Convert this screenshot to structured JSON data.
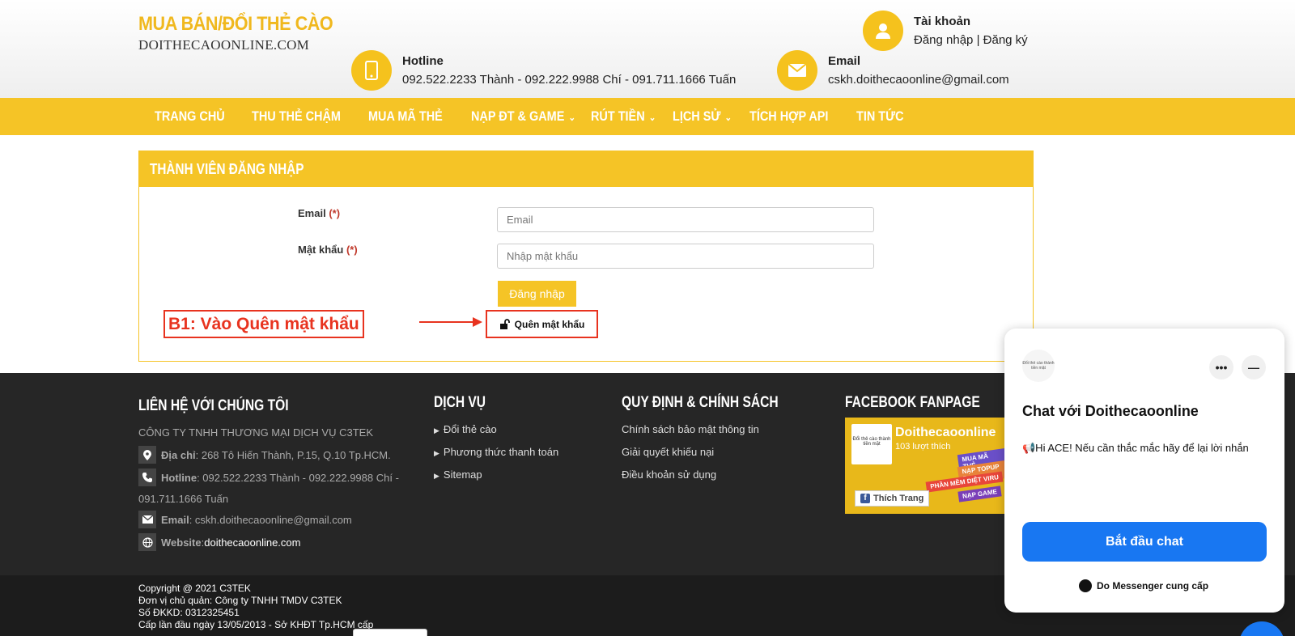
{
  "logo": {
    "top": "MUA BÁN/ĐỔI THẺ CÀO",
    "bottom": "DOITHECAOONLINE.COM"
  },
  "account": {
    "title": "Tài khoản",
    "login": "Đăng nhập",
    "separator": " | ",
    "register": "Đăng ký"
  },
  "hotline": {
    "title": "Hotline",
    "value": "092.522.2233 Thành - 092.222.9988 Chí - 091.711.1666 Tuấn"
  },
  "email": {
    "title": "Email",
    "value": "cskh.doithecaoonline@gmail.com"
  },
  "nav": [
    {
      "label": "TRANG CHỦ"
    },
    {
      "label": "THU THẺ CHẬM"
    },
    {
      "label": "MUA MÃ THẺ"
    },
    {
      "label": "NẠP ĐT & GAME",
      "chevron": "⌄"
    },
    {
      "label": "RÚT TIỀN",
      "chevron": "⌄"
    },
    {
      "label": "LỊCH SỬ",
      "chevron": "⌄"
    },
    {
      "label": "TÍCH HỢP API"
    },
    {
      "label": "TIN TỨC"
    }
  ],
  "login_panel": {
    "title": "THÀNH VIÊN ĐĂNG NHẬP",
    "email_label": "Email",
    "password_label": "Mật khẩu",
    "required": "(*)",
    "email_placeholder": "Email",
    "password_placeholder": "Nhập mật khẩu",
    "submit": "Đăng nhập",
    "forgot": "Quên mật khẩu",
    "annotation": "B1: Vào  Quên mật khẩu"
  },
  "footer": {
    "contact_title": "LIÊN HỆ VỚI CHÚNG TÔI",
    "company": "CÔNG TY TNHH THƯƠNG MẠI DỊCH VỤ C3TEK",
    "address_label": "Địa chỉ",
    "address": ": 268 Tô Hiến Thành, P.15, Q.10 Tp.HCM.",
    "hotline_label": "Hotline",
    "hotline": ": 092.522.2233 Thành - 092.222.9988 Chí -",
    "hotline_cont": "091.711.1666 Tuấn",
    "email_label": "Email",
    "email": ": cskh.doithecaoonline@gmail.com",
    "website_label": "Website",
    "website_sep": ": ",
    "website": "doithecaoonline.com",
    "services_title": "DỊCH VỤ",
    "services": [
      "Đổi thẻ cào",
      "Phương thức thanh toán",
      "Sitemap"
    ],
    "policy_title": "QUY ĐỊNH & CHÍNH SÁCH",
    "policies": [
      "Chính sách bảo mật thông tin",
      "Giải quyết khiếu nại",
      "Điều khoản sử dụng"
    ],
    "fanpage_title": "FACEBOOK FANPAGE",
    "fanpage_name": "Doithecaoonline",
    "fanpage_likes": "103 lượt thích",
    "fanpage_like_btn": "Thích Trang",
    "fanpage_banners": [
      "MUA MÃ THẺ",
      "NẠP TOPUP Đ",
      "PHẦN MỀM DIỆT VIRU",
      "NẠP GAME"
    ],
    "avatar_text": "Đổi thẻ cào thành tiền mặt"
  },
  "copyright": [
    "Copyright @ 2021 C3TEK",
    "Đơn vị chủ quản: Công ty TNHH TMDV C3TEK",
    "Số ĐKKD: 0312325451",
    "Cấp lần đầu ngày 13/05/2013 - Sở KHĐT Tp.HCM cấp"
  ],
  "chat": {
    "avatar_text": "Đổi thẻ cào thành tiền mặt",
    "more": "•••",
    "minimize": "—",
    "title": "Chat với Doithecaoonline",
    "message": "📢Hi ACE! Nếu cần thắc mắc hãy để lại lời nhắn",
    "start": "Bắt đầu chat",
    "powered": "Do Messenger cung cấp"
  },
  "colors": {
    "brand": "#f5c426",
    "annotation": "#e8331f",
    "messenger": "#1877f2",
    "footer": "#262626"
  }
}
